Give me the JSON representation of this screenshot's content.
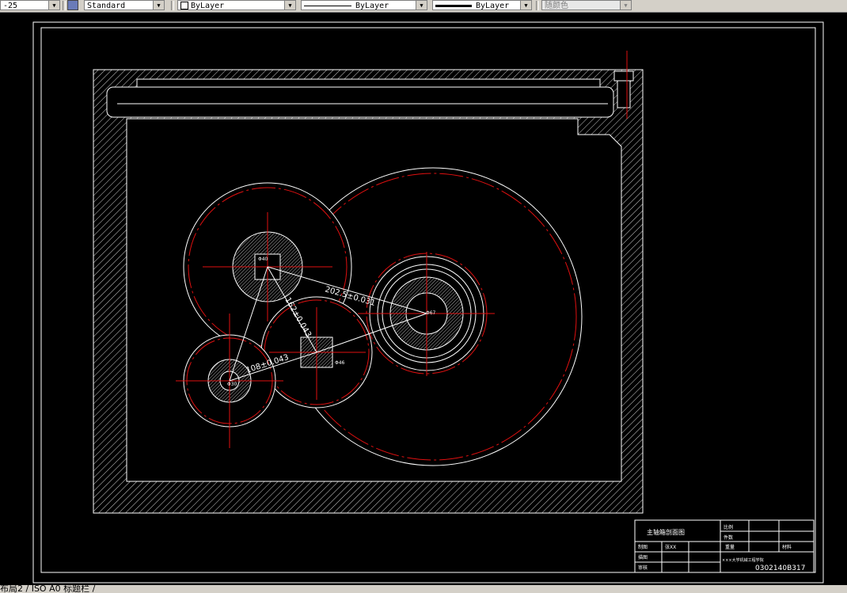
{
  "toolbar": {
    "dimstyle_value": "-25",
    "textstyle_value": "Standard",
    "layer_value": "ByLayer",
    "linetype_value": "ByLayer",
    "lineweight_value": "ByLayer",
    "plotstyle_value": "随颜色"
  },
  "drawing": {
    "dim_upper": "202.5±0.031",
    "dim_center": "162±0.043",
    "dim_lower": "108±0.043",
    "label_upper_gear": "Φ40",
    "label_middle_gear": "Φ46",
    "label_right_gear": "Φ67",
    "label_small_gear": "Φ30"
  },
  "title_block": {
    "drawing_name": "主轴箱剖面图",
    "scale_label": "比例",
    "parts_label": "件数",
    "designer_label": "制图",
    "designer_name": "张XX",
    "weight_label": "重量",
    "material_label": "材料",
    "check_label": "描图",
    "review_label": "审核",
    "school": "×××大学机械工程学院",
    "drawing_no": "0302140B317"
  },
  "tabs": {
    "label": "布局2 / ISO A0 标题栏 /"
  }
}
